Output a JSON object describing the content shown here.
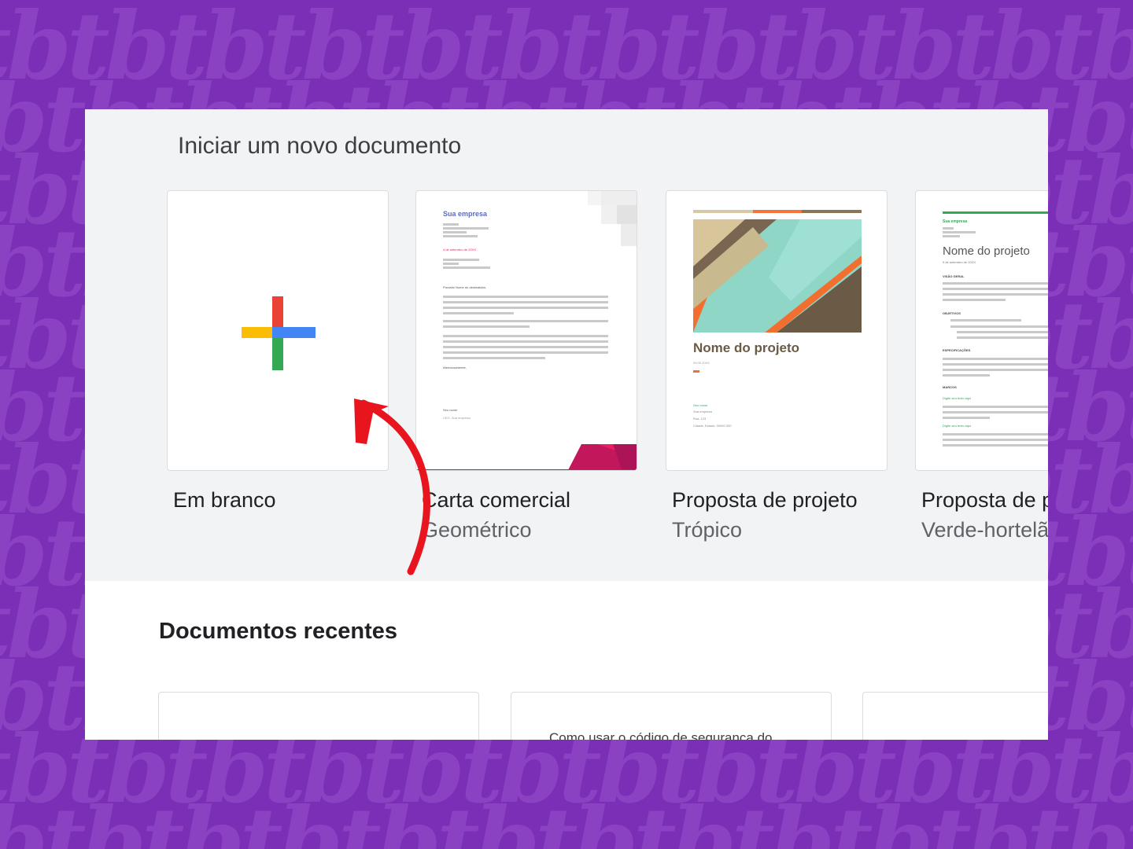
{
  "templates_section": {
    "title": "Iniciar um novo documento",
    "templates": [
      {
        "name": "Em branco",
        "subtitle": ""
      },
      {
        "name": "Carta comercial",
        "subtitle": "Geométrico",
        "thumb": {
          "company": "Sua empresa",
          "date": "4 de setembro de 20XX",
          "greeting": "Prezado Nome do destinatário,",
          "closing": "Atenciosamente,",
          "signature": "Seu nome",
          "signature_title": "CEO, Sua empresa"
        }
      },
      {
        "name": "Proposta de projeto",
        "subtitle": "Trópico",
        "thumb": {
          "project_name": "Nome do projeto",
          "date": "09.09.20XX",
          "author": "Seu nome",
          "company": "Sua empresa",
          "address_1": "Rua, 123",
          "address_2": "Cidade, Estado, 00000 000"
        }
      },
      {
        "name": "Proposta de p",
        "subtitle": "Verde-hortelã",
        "thumb": {
          "company": "Sua empresa",
          "project_name": "Nome do projeto",
          "date": "9 de setembro de 20XX",
          "overview": "VISÃO GERAL",
          "objectives": "OBJETIVOS",
          "specs": "ESPECIFICAÇÕES",
          "milestones": "MARCOS",
          "milestone_text_1": "Digite seu texto aqui",
          "milestone_text_2": "Digite seu texto aqui"
        }
      }
    ]
  },
  "recent_section": {
    "title": "Documentos recentes",
    "documents": [
      {
        "preview": ""
      },
      {
        "preview": "Como usar o código de segurança do"
      },
      {
        "preview": ""
      }
    ]
  },
  "colors": {
    "background": "#7b2fb6",
    "watermark": "#8a42c3",
    "arrow": "#e8141e",
    "google_red": "#ea4335",
    "google_blue": "#4285f4",
    "google_yellow": "#fbbc04",
    "google_green": "#34a853"
  },
  "watermark_text": "tbtbtbtbtbtbtbtbtbtbtbtbtb"
}
